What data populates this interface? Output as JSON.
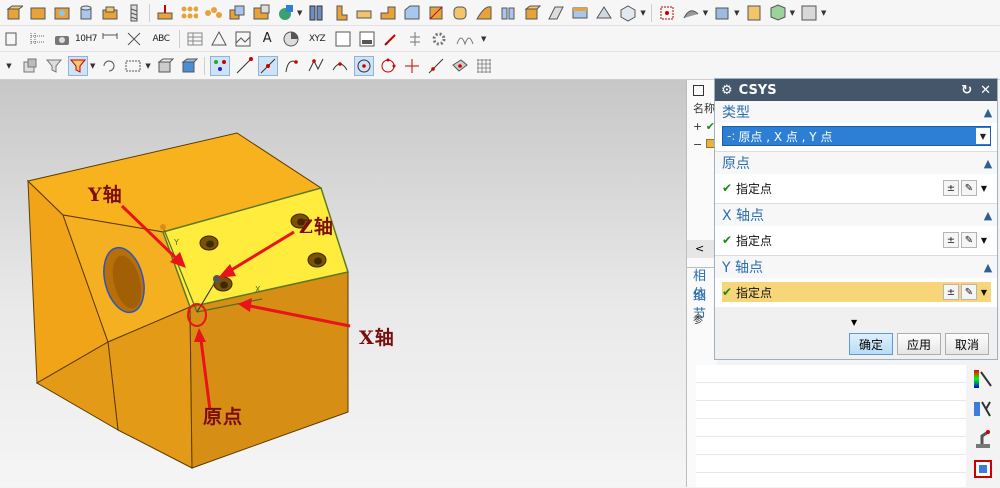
{
  "toolbar": {
    "row2_text": {
      "tolerance": "10H7",
      "abc": "ABC",
      "xyz": "XYZ"
    }
  },
  "annotations": {
    "y_axis": "Y轴",
    "z_axis": "Z轴",
    "x_axis": "X轴",
    "origin": "原点"
  },
  "model_labels": {
    "y": "Y",
    "x": "X"
  },
  "navigator": {
    "header_partial": "名称",
    "plus_row": "+",
    "minus_row": "−",
    "tab_related": "相依",
    "tab_detail": "细节",
    "column_partial": "参",
    "scroll_left": "<"
  },
  "dialog": {
    "title": "CSYS",
    "groups": {
      "type": {
        "label": "类型",
        "value": "原点 , X 点 , Y 点",
        "value_icon": "-:"
      },
      "origin": {
        "label": "原点",
        "point_label": "指定点"
      },
      "x_point": {
        "label": "X 轴点",
        "point_label": "指定点"
      },
      "y_point": {
        "label": "Y 轴点",
        "point_label": "指定点"
      }
    },
    "buttons": {
      "ok": "确定",
      "apply": "应用",
      "cancel": "取消"
    }
  },
  "colors": {
    "accent": "#2d7fd6",
    "highlight": "#f6d679",
    "model_orange": "#f2a418",
    "model_face_yellow": "#ffec3d",
    "annotation_red": "#e8141a"
  }
}
